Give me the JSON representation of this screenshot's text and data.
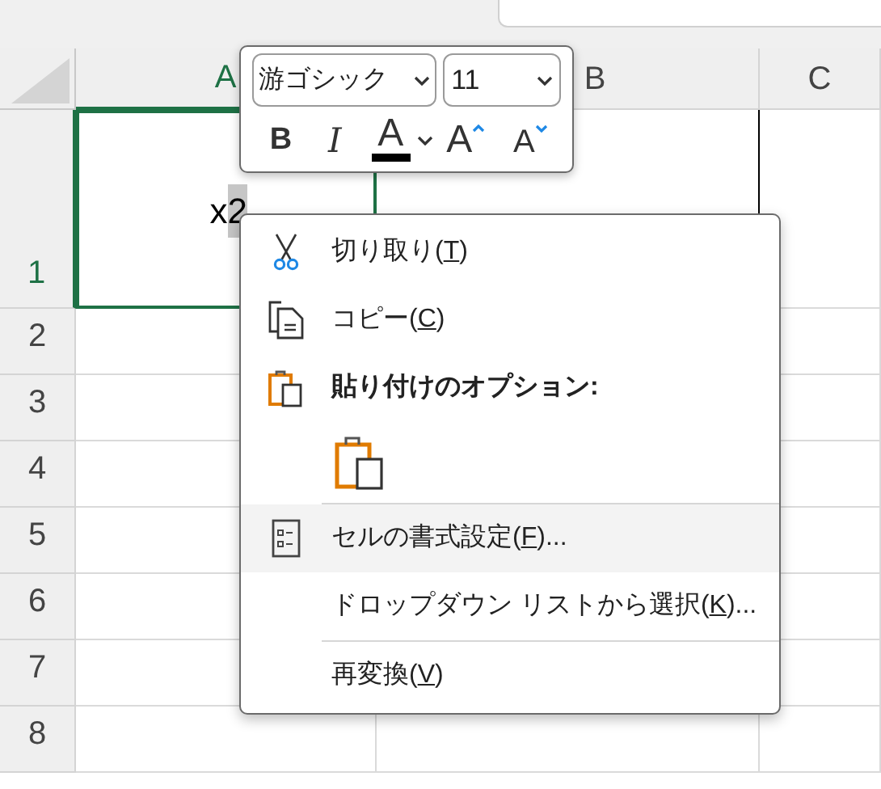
{
  "columns": [
    {
      "label": "A",
      "selected": true
    },
    {
      "label": "B",
      "selected": false
    },
    {
      "label": "C",
      "selected": false
    }
  ],
  "rows": [
    {
      "label": "1",
      "selected": true,
      "kind": "tall"
    },
    {
      "label": "2",
      "selected": false,
      "kind": "normal"
    },
    {
      "label": "3",
      "selected": false,
      "kind": "normal"
    },
    {
      "label": "4",
      "selected": false,
      "kind": "normal"
    },
    {
      "label": "5",
      "selected": false,
      "kind": "normal"
    },
    {
      "label": "6",
      "selected": false,
      "kind": "normal"
    },
    {
      "label": "7",
      "selected": false,
      "kind": "normal"
    },
    {
      "label": "8",
      "selected": false,
      "kind": "normal"
    }
  ],
  "active_cell": {
    "text": "x",
    "selected_text": "2"
  },
  "mini_toolbar": {
    "font": "游ゴシック",
    "size": "11",
    "buttons": [
      {
        "kind": "bold",
        "label": "B"
      },
      {
        "kind": "italic",
        "label": "I"
      },
      {
        "kind": "font_color",
        "label": "A"
      },
      {
        "kind": "grow",
        "label": "A"
      },
      {
        "kind": "shrink",
        "label": "A"
      }
    ]
  },
  "context_menu": [
    {
      "kind": "command",
      "before": "切り取り(",
      "key": "T",
      "after": ")",
      "hovered": false
    },
    {
      "kind": "command",
      "before": "コピー(",
      "key": "C",
      "after": ")",
      "hovered": false
    },
    {
      "kind": "heading",
      "label": "貼り付けのオプション:"
    },
    {
      "kind": "paste_option"
    },
    {
      "kind": "separator"
    },
    {
      "kind": "command",
      "before": "セルの書式設定(",
      "key": "F",
      "after": ")...",
      "hovered": true
    },
    {
      "kind": "command",
      "before": "ドロップダウン リストから選択(",
      "key": "K",
      "after": ")...",
      "hovered": false
    },
    {
      "kind": "separator"
    },
    {
      "kind": "command",
      "before": "再変換(",
      "key": "V",
      "after": ")",
      "hovered": false
    }
  ]
}
